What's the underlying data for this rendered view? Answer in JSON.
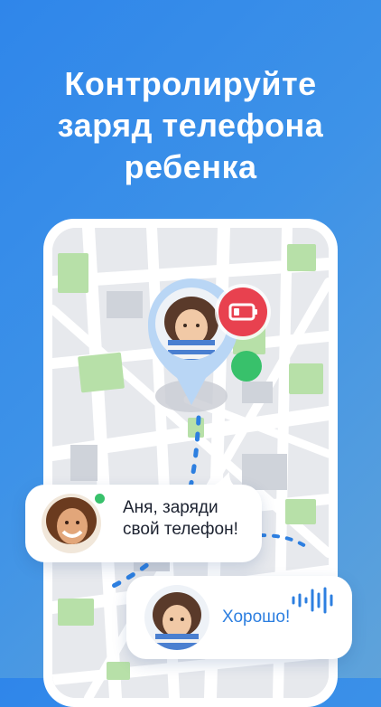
{
  "headline": {
    "line1": "Контролируйте",
    "line2": "заряд телефона",
    "line3": "ребенка"
  },
  "colors": {
    "background_start": "#2f86ea",
    "background_end": "#5fa3da",
    "battery_badge": "#e8414f",
    "online": "#38c16b",
    "route": "#2d7fe0",
    "reply_text": "#2d7fe0"
  },
  "map_pin": {
    "battery_icon": "battery-low-icon",
    "status_icon": "online-dot-icon"
  },
  "chat": {
    "parent_message": "Аня, заряди свой телефон!",
    "child_reply": "Хорошо!",
    "voice_icon": "voice-wave-icon"
  }
}
